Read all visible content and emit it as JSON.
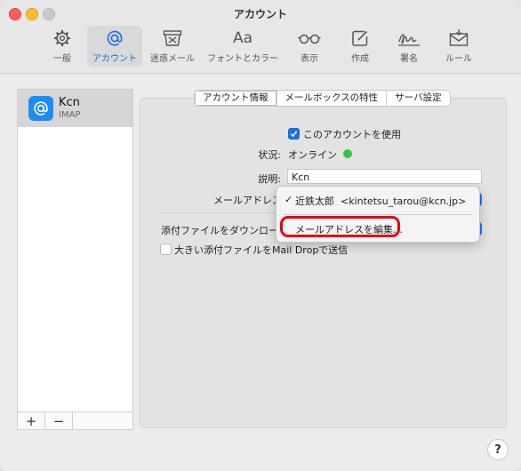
{
  "window": {
    "title": "アカウント"
  },
  "toolbar": [
    {
      "label": "一般",
      "icon": "gear-icon"
    },
    {
      "label": "アカウント",
      "icon": "at-icon",
      "active": true
    },
    {
      "label": "迷惑メール",
      "icon": "junk-trash-icon"
    },
    {
      "label": "フォントとカラー",
      "icon": "font-icon",
      "glyph": "Aa"
    },
    {
      "label": "表示",
      "icon": "glasses-icon"
    },
    {
      "label": "作成",
      "icon": "compose-icon"
    },
    {
      "label": "署名",
      "icon": "signature-icon"
    },
    {
      "label": "ルール",
      "icon": "rules-envelope-icon"
    }
  ],
  "sidebar": {
    "accounts": [
      {
        "name": "Kcn",
        "type": "IMAP",
        "icon": "at-icon"
      }
    ],
    "add_label": "+",
    "remove_label": "−"
  },
  "tabs": [
    {
      "label": "アカウント情報",
      "selected": true
    },
    {
      "label": "メールボックスの特性"
    },
    {
      "label": "サーバ設定"
    }
  ],
  "form": {
    "enable_account": {
      "label": "このアカウントを使用",
      "checked": true
    },
    "status": {
      "label": "状況:",
      "value": "オンライン",
      "color": "#2bc941"
    },
    "description": {
      "label": "説明:",
      "value": "Kcn"
    },
    "email_address": {
      "label": "メールアドレス"
    },
    "download_attachments": {
      "label": "添付ファイルをダウンロード"
    },
    "mail_drop": {
      "label": "大きい添付ファイルをMail Dropで送信",
      "checked": false
    }
  },
  "email_menu": {
    "items": [
      {
        "label": "近鉄太郎  <kintetsu_tarou@kcn.jp>",
        "checked": true
      },
      {
        "label": "メールアドレスを編集…",
        "highlighted": true
      }
    ]
  },
  "help": {
    "label": "?"
  },
  "colors": {
    "accent": "#1d73ef",
    "highlight": "#e60012"
  }
}
